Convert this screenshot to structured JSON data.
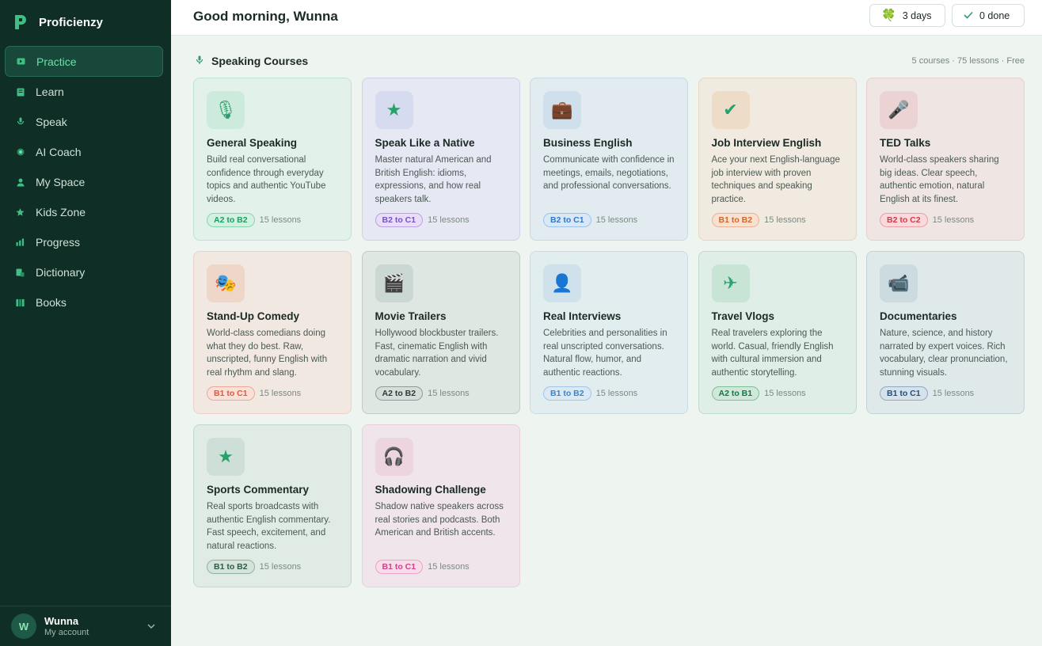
{
  "brand": {
    "name": "Proficienzy",
    "color": "#3fbf86"
  },
  "nav": [
    {
      "label": "Practice",
      "icon": "video-icon",
      "active": true
    },
    {
      "label": "Learn",
      "icon": "book-icon",
      "active": false
    },
    {
      "label": "Speak",
      "icon": "mic-icon",
      "active": false
    },
    {
      "label": "AI Coach",
      "icon": "coach-icon",
      "active": false
    },
    {
      "label": "My Space",
      "icon": "user-icon",
      "active": false
    },
    {
      "label": "Kids Zone",
      "icon": "star-icon",
      "active": false
    },
    {
      "label": "Progress",
      "icon": "bar-chart-icon",
      "active": false
    },
    {
      "label": "Dictionary",
      "icon": "dictionary-icon",
      "active": false
    },
    {
      "label": "Books",
      "icon": "books-icon",
      "active": false
    }
  ],
  "user": {
    "initial": "W",
    "name": "Wunna",
    "subtitle": "My account"
  },
  "header": {
    "greeting": "Good morning, Wunna",
    "streak_label": "3 days",
    "done_label": "0 done"
  },
  "section": {
    "title": "Speaking Courses",
    "meta": "5 courses · 75 lessons · Free"
  },
  "courses": [
    {
      "title": "General Speaking",
      "desc": "Build real conversational confidence through everyday topics and authentic YouTube videos.",
      "level": "A2 to B2",
      "lessons": "15 lessons",
      "icon": "microphone-icon",
      "glyph": "🎙",
      "bg": "#e2f2ea",
      "border": "#bfe3cf",
      "iconbg": "#cdebdc",
      "badge_fg": "#1e9d62",
      "badge_bg": "#d3f1e1",
      "badge_border": "#86d4ad"
    },
    {
      "title": "Speak Like a Native",
      "desc": "Master natural American and British English: idioms, expressions, and how real speakers talk.",
      "level": "B2 to C1",
      "lessons": "15 lessons",
      "icon": "star-icon",
      "glyph": "★",
      "bg": "#e6e8f3",
      "border": "#cdd2ea",
      "iconbg": "#d7dbf0",
      "badge_fg": "#7a52c7",
      "badge_bg": "#e8def8",
      "badge_border": "#b9a2e6"
    },
    {
      "title": "Business English",
      "desc": "Communicate with confidence in meetings, emails, negotiations, and professional conversations.",
      "level": "B2 to C1",
      "lessons": "15 lessons",
      "icon": "briefcase-icon",
      "glyph": "💼",
      "bg": "#e2ecf0",
      "border": "#c5d9e6",
      "iconbg": "#cfe0ec",
      "badge_fg": "#2f77c9",
      "badge_bg": "#d9e8f7",
      "badge_border": "#9cc2ea"
    },
    {
      "title": "Job Interview English",
      "desc": "Ace your next English-language job interview with proven techniques and speaking practice.",
      "level": "B1 to B2",
      "lessons": "15 lessons",
      "icon": "check-circle-icon",
      "glyph": "✔",
      "bg": "#f0eae1",
      "border": "#e6d6c2",
      "iconbg": "#eddcc8",
      "badge_fg": "#d2662a",
      "badge_bg": "#f9e1d2",
      "badge_border": "#eab293"
    },
    {
      "title": "TED Talks",
      "desc": "World-class speakers sharing big ideas. Clear speech, authentic emotion, natural English at its finest.",
      "level": "B2 to C2",
      "lessons": "15 lessons",
      "icon": "speaker-icon",
      "glyph": "🎤",
      "bg": "#efe6e3",
      "border": "#e6cfcc",
      "iconbg": "#ebd3d3",
      "badge_fg": "#d23a46",
      "badge_bg": "#f9d9dc",
      "badge_border": "#eba0a6"
    },
    {
      "title": "Stand-Up Comedy",
      "desc": "World-class comedians doing what they do best. Raw, unscripted, funny English with real rhythm and slang.",
      "level": "B1 to C1",
      "lessons": "15 lessons",
      "icon": "comedy-masks-icon",
      "glyph": "🎭",
      "bg": "#f0e8e1",
      "border": "#ead3c6",
      "iconbg": "#eed6c8",
      "badge_fg": "#e0583a",
      "badge_bg": "#fbe0d7",
      "badge_border": "#efa896"
    },
    {
      "title": "Movie Trailers",
      "desc": "Hollywood blockbuster trailers. Fast, cinematic English with dramatic narration and vivid vocabulary.",
      "level": "A2 to B2",
      "lessons": "15 lessons",
      "icon": "clapperboard-icon",
      "glyph": "🎬",
      "bg": "#dfe7e3",
      "border": "#bfcdc7",
      "iconbg": "#cbd7d2",
      "badge_fg": "#2e3a36",
      "badge_bg": "#d5dedb",
      "badge_border": "#8e9e97"
    },
    {
      "title": "Real Interviews",
      "desc": "Celebrities and personalities in real unscripted conversations. Natural flow, humor, and authentic reactions.",
      "level": "B1 to B2",
      "lessons": "15 lessons",
      "icon": "interview-person-icon",
      "glyph": "👤",
      "bg": "#e2edf0",
      "border": "#c6dbe4",
      "iconbg": "#cfe1ea",
      "badge_fg": "#3a85c4",
      "badge_bg": "#dbe9f5",
      "badge_border": "#a2c6e6"
    },
    {
      "title": "Travel Vlogs",
      "desc": "Real travelers exploring the world. Casual, friendly English with cultural immersion and authentic storytelling.",
      "level": "A2 to B1",
      "lessons": "15 lessons",
      "icon": "airplane-icon",
      "glyph": "✈",
      "bg": "#dfeee6",
      "border": "#bcdcc9",
      "iconbg": "#c8e4d4",
      "badge_fg": "#16744a",
      "badge_bg": "#cfe8d9",
      "badge_border": "#7ebf98"
    },
    {
      "title": "Documentaries",
      "desc": "Nature, science, and history narrated by expert voices. Rich vocabulary, clear pronunciation, stunning visuals.",
      "level": "B1 to C1",
      "lessons": "15 lessons",
      "icon": "camera-icon",
      "glyph": "📹",
      "bg": "#dfe9ea",
      "border": "#c1d4d8",
      "iconbg": "#cbdbe0",
      "badge_fg": "#1f4f7a",
      "badge_bg": "#d5e2ec",
      "badge_border": "#8eaac4"
    },
    {
      "title": "Sports Commentary",
      "desc": "Real sports broadcasts with authentic English commentary. Fast speech, excitement, and natural reactions.",
      "level": "B1 to B2",
      "lessons": "15 lessons",
      "icon": "trophy-star-icon",
      "glyph": "★",
      "bg": "#e0ebe6",
      "border": "#c3d8cd",
      "iconbg": "#cddfd6",
      "badge_fg": "#2d5a45",
      "badge_bg": "#d4e4db",
      "badge_border": "#8fb39f"
    },
    {
      "title": "Shadowing Challenge",
      "desc": "Shadow native speakers across real stories and podcasts. Both American and British accents.",
      "level": "B1 to C1",
      "lessons": "15 lessons",
      "icon": "headphones-icon",
      "glyph": "🎧",
      "bg": "#efe5ea",
      "border": "#e8cfdc",
      "iconbg": "#ecd4e0",
      "badge_fg": "#d2408a",
      "badge_bg": "#f8dcea",
      "badge_border": "#eba4c8"
    }
  ]
}
